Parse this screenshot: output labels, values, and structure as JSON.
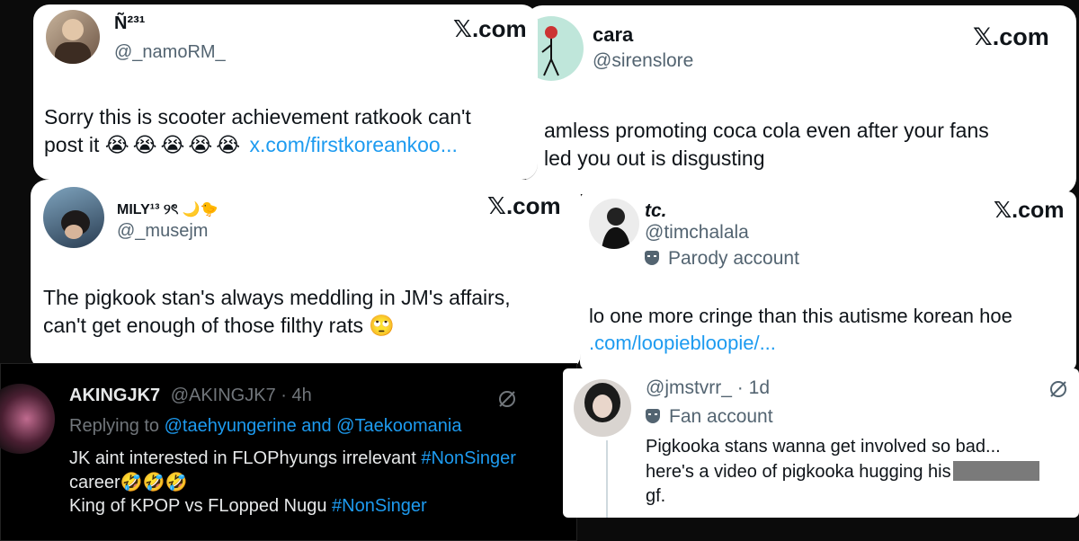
{
  "card1": {
    "name": "Ñ²³¹",
    "handle": "@_namoRM_",
    "brand": "𝕏.com",
    "text": "Sorry this is scooter achievement ratkook can't",
    "text2_prefix": "post it",
    "emojis": "😭😭😭😭😭",
    "link": "x.com/firstkoreankoo..."
  },
  "card2": {
    "name": "cara",
    "handle": "@sirenslore",
    "brand": "𝕏.com",
    "line1": "amless promoting coca cola even after your fans",
    "line2": "led you out is disgusting"
  },
  "card3": {
    "name": "MILY¹³ ୨ৎ 🌙🐤",
    "handle": "@_musejm",
    "brand": "𝕏.com",
    "line1": "The pigkook stan's always meddling in JM's affairs,",
    "line2": "can't get enough of those filthy rats 🙄"
  },
  "card4": {
    "name": "tc.",
    "handle": "@timchalala",
    "badge": "Parody account",
    "brand": "𝕏.com",
    "line1": "lo one more cringe than this autisme korean hoe",
    "link": ".com/loopiebloopie/..."
  },
  "card5": {
    "name": "AKINGJK7",
    "handle": "@AKINGJK7 · 4h",
    "reply_prefix": "Replying to",
    "reply_to": "@taehyungerine and @Taekoomania",
    "line1_prefix": "JK aint interested in FLOPhyungs irrelevant",
    "line1_tag": "#NonSinger",
    "line2": "career🤣🤣🤣",
    "line3_prefix": "King of KPOP  vs FLopped Nugu",
    "line3_tag": "#NonSinger"
  },
  "card6": {
    "handle": "@jmstvrr_ · 1d",
    "badge": "Fan account",
    "line1": "Pigkooka stans wanna get involved so bad...",
    "line2": "here's a video of pigkooka hugging his",
    "line3": "gf."
  }
}
